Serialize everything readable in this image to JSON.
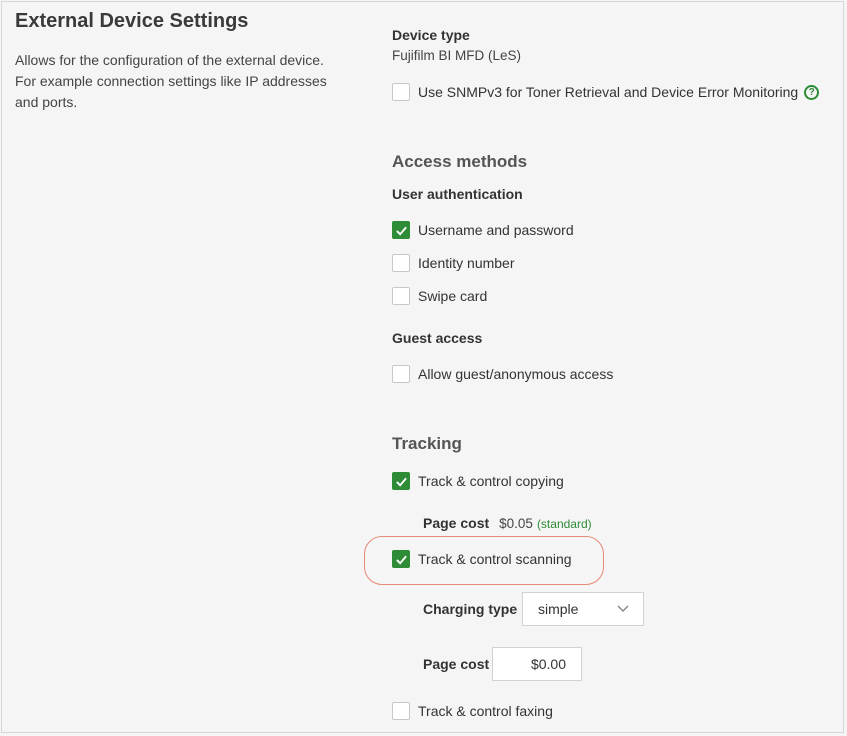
{
  "section": {
    "title": "External Device Settings",
    "description": "Allows for the configuration of the external device. For example connection settings like IP addresses and ports."
  },
  "device": {
    "type_label": "Device type",
    "type_value": "Fujifilm BI MFD (LeS)",
    "snmp_label": "Use SNMPv3 for Toner Retrieval and Device Error Monitoring",
    "snmp_checked": false,
    "help_glyph": "?"
  },
  "access": {
    "heading": "Access methods",
    "user_auth_label": "User authentication",
    "options": [
      {
        "label": "Username and password",
        "checked": true
      },
      {
        "label": "Identity number",
        "checked": false
      },
      {
        "label": "Swipe card",
        "checked": false
      }
    ],
    "guest_label": "Guest access",
    "guest_option": {
      "label": "Allow guest/anonymous access",
      "checked": false
    }
  },
  "tracking": {
    "heading": "Tracking",
    "copying": {
      "label": "Track & control copying",
      "checked": true
    },
    "copy_page_cost_label": "Page cost",
    "copy_page_cost_value": "$0.05",
    "copy_page_cost_tag": "(standard)",
    "scanning": {
      "label": "Track & control scanning",
      "checked": true
    },
    "charging_type_label": "Charging type",
    "charging_type_value": "simple",
    "scan_page_cost_label": "Page cost",
    "scan_page_cost_value": "$0.00",
    "faxing": {
      "label": "Track & control faxing",
      "checked": false
    }
  },
  "colors": {
    "accent": "#2e8b36",
    "highlight": "#e8897a"
  }
}
